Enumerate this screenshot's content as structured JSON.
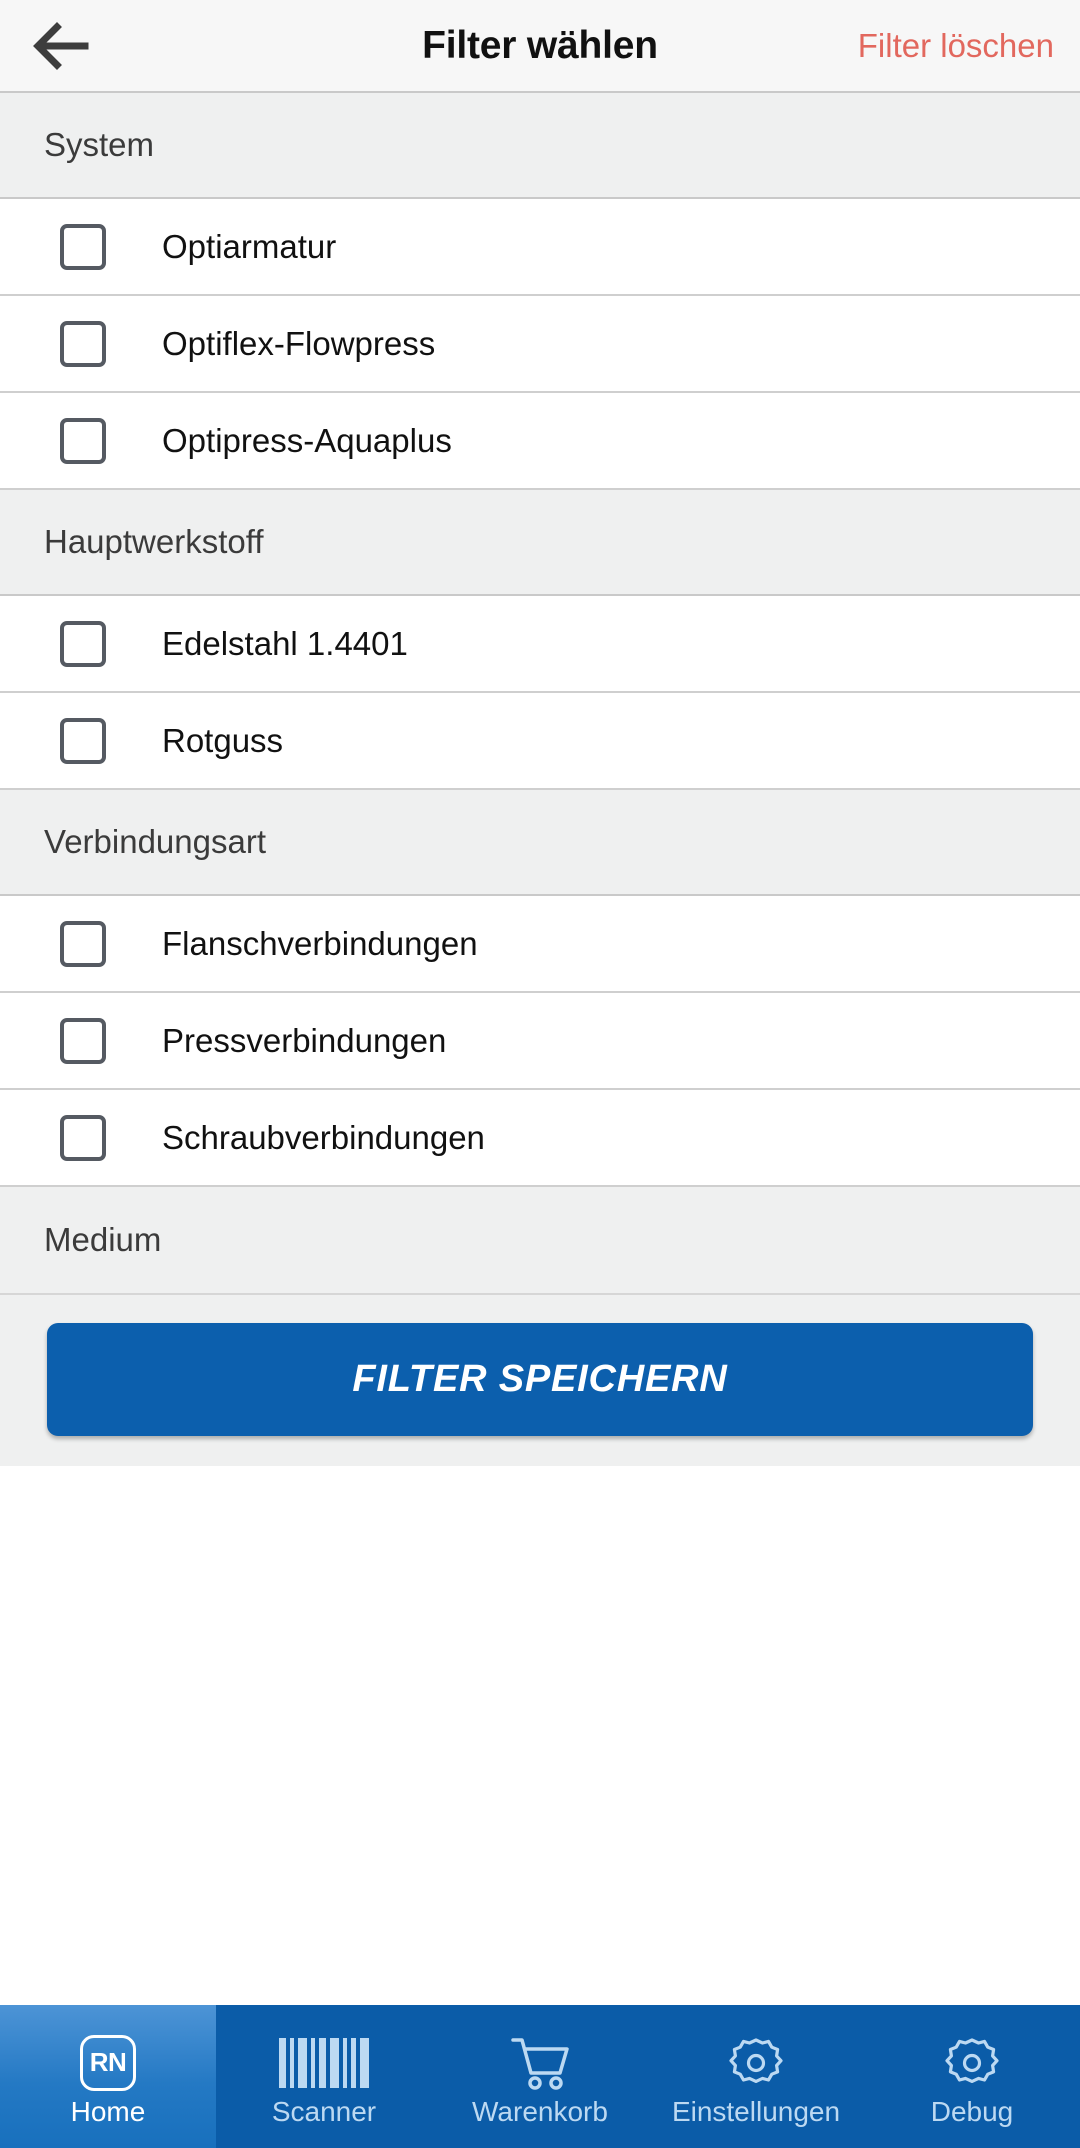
{
  "header": {
    "back_icon": "arrow-left-icon",
    "title": "Filter wählen",
    "action_label": "Filter löschen",
    "action_color": "#e2685e"
  },
  "filter_sections": [
    {
      "title": "System",
      "options": [
        {
          "label": "Optiarmatur",
          "checked": false
        },
        {
          "label": "Optiflex-Flowpress",
          "checked": false
        },
        {
          "label": "Optipress-Aquaplus",
          "checked": false
        }
      ]
    },
    {
      "title": "Hauptwerkstoff",
      "options": [
        {
          "label": "Edelstahl 1.4401",
          "checked": false
        },
        {
          "label": "Rotguss",
          "checked": false
        }
      ]
    },
    {
      "title": "Verbindungsart",
      "options": [
        {
          "label": "Flanschverbindungen",
          "checked": false
        },
        {
          "label": "Pressverbindungen",
          "checked": false
        },
        {
          "label": "Schraubverbindungen",
          "checked": false
        }
      ]
    },
    {
      "title": "Medium",
      "options": []
    }
  ],
  "footer": {
    "save_label": "FILTER SPEICHERN",
    "save_color": "#0c5fad"
  },
  "bottom_nav": {
    "background": "#0b5ca8",
    "items": [
      {
        "label": "Home",
        "icon": "rn-logo-icon",
        "logo_text": "RN",
        "active": true
      },
      {
        "label": "Scanner",
        "icon": "barcode-icon",
        "active": false
      },
      {
        "label": "Warenkorb",
        "icon": "shopping-cart-icon",
        "active": false
      },
      {
        "label": "Einstellungen",
        "icon": "gear-icon",
        "active": false
      },
      {
        "label": "Debug",
        "icon": "gear-icon",
        "active": false
      }
    ]
  }
}
